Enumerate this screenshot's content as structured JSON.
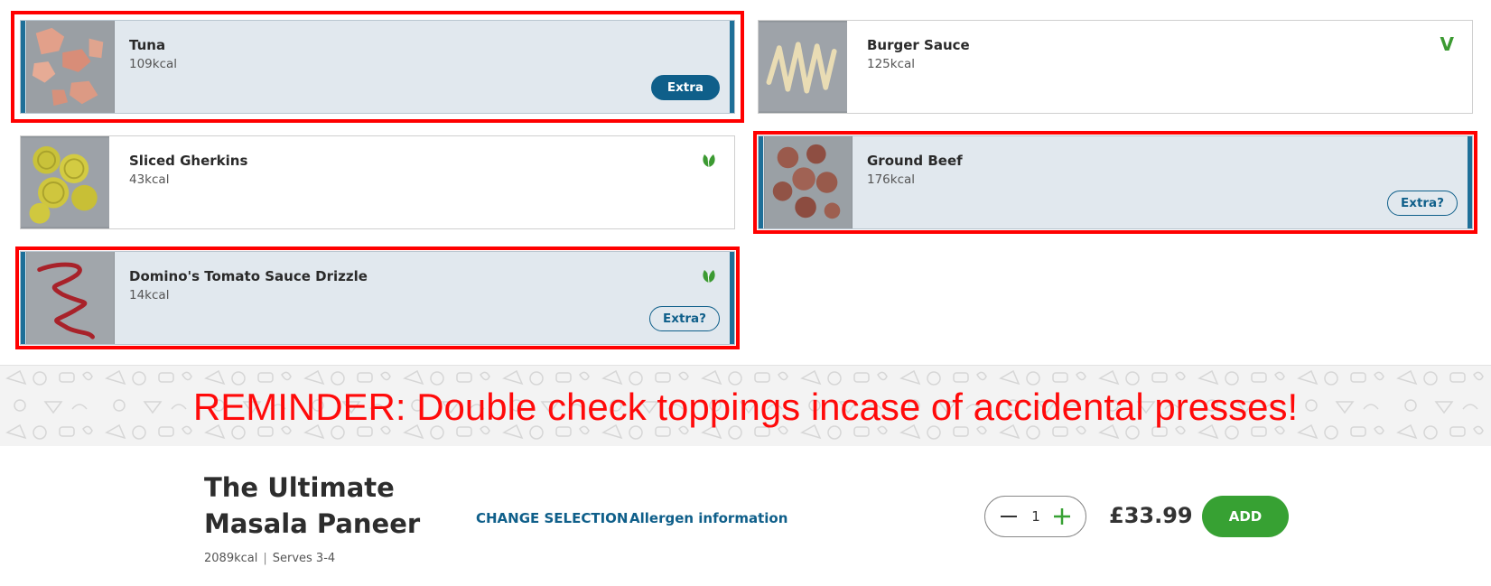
{
  "toppings": [
    {
      "name": "Tuna",
      "kcal": "109kcal",
      "selected": true,
      "diet_icon": "none",
      "button": "Extra",
      "button_style": "filled"
    },
    {
      "name": "Burger Sauce",
      "kcal": "125kcal",
      "selected": false,
      "diet_icon": "vegetarian-v-icon",
      "button": "",
      "button_style": "none"
    },
    {
      "name": "Sliced Gherkins",
      "kcal": "43kcal",
      "selected": false,
      "diet_icon": "vegan-leaf-icon",
      "button": "",
      "button_style": "none"
    },
    {
      "name": "Ground Beef",
      "kcal": "176kcal",
      "selected": true,
      "diet_icon": "none",
      "button": "Extra?",
      "button_style": "outline"
    },
    {
      "name": "Domino's Tomato Sauce Drizzle",
      "kcal": "14kcal",
      "selected": true,
      "diet_icon": "vegan-leaf-icon",
      "button": "Extra?",
      "button_style": "outline"
    }
  ],
  "vegetarian_mark": "V",
  "reminder": "REMINDER: Double check toppings incase of accidental presses!",
  "product": {
    "title": "The Ultimate Masala Paneer",
    "kcal": "2089kcal",
    "separator": "|",
    "serves": "Serves 3-4",
    "change_selection": "CHANGE SELECTION",
    "allergen": "Allergen information",
    "quantity": "1",
    "price": "£33.99",
    "add_label": "ADD"
  },
  "colors": {
    "selected_bg": "#e1e8ee",
    "selected_accent": "#1e6f98",
    "highlight": "#ff0000",
    "brand_blue": "#0f5f8a",
    "add_green": "#37a133",
    "reminder_red": "#ff0a0a"
  }
}
